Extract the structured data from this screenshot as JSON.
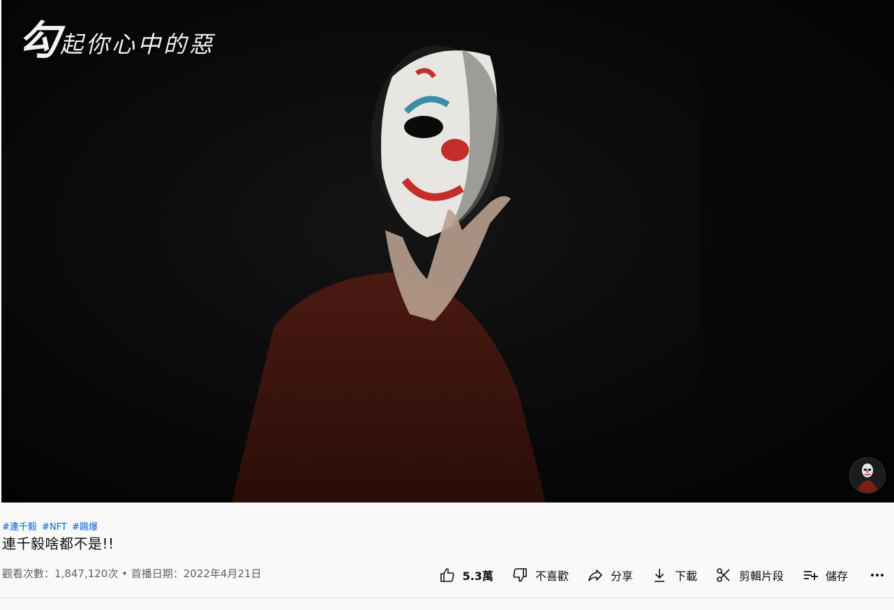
{
  "video": {
    "watermark_big": "勾",
    "watermark_text": "起你心中的惡"
  },
  "hashtags": [
    "#連千毅",
    "#NFT",
    "#踢爆"
  ],
  "title": "連千毅啥都不是!!",
  "meta": {
    "views": "觀看次數：1,847,120次",
    "separator": " • ",
    "date": "首播日期：2022年4月21日"
  },
  "actions": {
    "like_count": "5.3萬",
    "dislike_label": "不喜歡",
    "share_label": "分享",
    "download_label": "下載",
    "clip_label": "剪輯片段",
    "save_label": "儲存"
  },
  "icons": {
    "like": "thumbs-up-icon",
    "dislike": "thumbs-down-icon",
    "share": "share-arrow-icon",
    "download": "download-icon",
    "clip": "scissors-icon",
    "save": "playlist-add-icon",
    "more": "more-horizontal-icon"
  },
  "colors": {
    "hashtag": "#065fd4",
    "background": "#f9f9f9",
    "text": "#0f0f0f",
    "meta_text": "#606060"
  }
}
